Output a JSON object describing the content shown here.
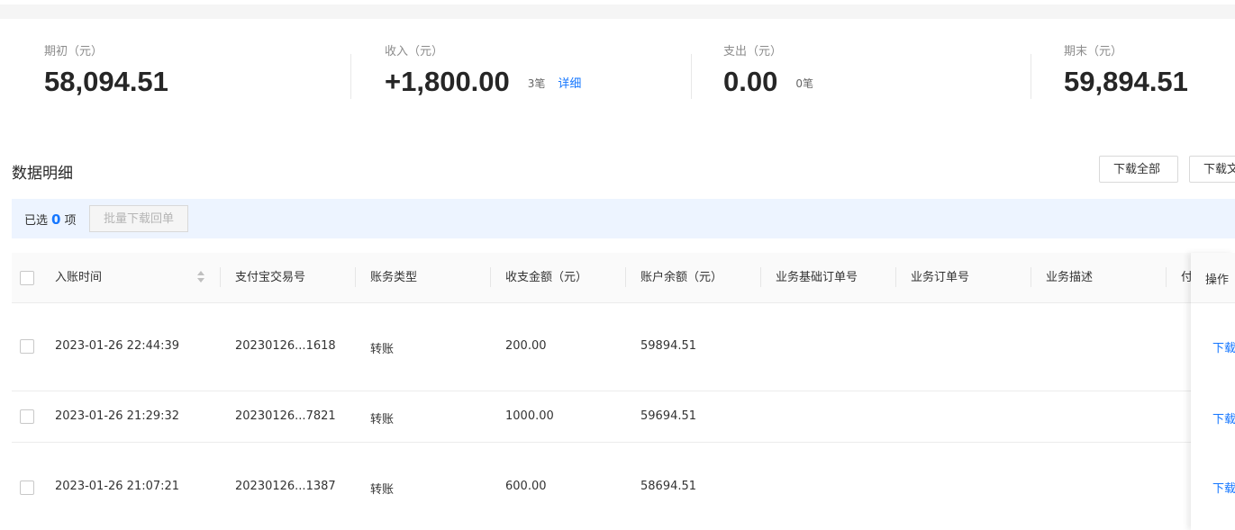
{
  "summary": {
    "opening": {
      "label": "期初（元）",
      "value": "58,094.51"
    },
    "income": {
      "label": "收入（元）",
      "value": "+1,800.00",
      "count": "3笔",
      "detail_link": "详细"
    },
    "expense": {
      "label": "支出（元）",
      "value": "0.00",
      "count": "0笔"
    },
    "closing": {
      "label": "期末（元）",
      "value": "59,894.51"
    }
  },
  "section": {
    "title": "数据明细",
    "download_all": "下载全部",
    "download_other": "下载文"
  },
  "selection": {
    "prefix": "已选",
    "count": "0",
    "suffix": "项",
    "batch_download": "批量下载回单"
  },
  "table": {
    "columns": [
      "入账时间",
      "支付宝交易号",
      "账务类型",
      "收支金额（元）",
      "账户余额（元）",
      "业务基础订单号",
      "业务订单号",
      "业务描述",
      "付"
    ],
    "action_header": "操作",
    "rows": [
      {
        "time": "2023-01-26 22:44:39",
        "trade_no": "20230126...1618",
        "type": "转账",
        "amount": "200.00",
        "balance": "59894.51",
        "action": "下载"
      },
      {
        "time": "2023-01-26 21:29:32",
        "trade_no": "20230126...7821",
        "type": "转账",
        "amount": "1000.00",
        "balance": "59694.51",
        "action": "下载"
      },
      {
        "time": "2023-01-26 21:07:21",
        "trade_no": "20230126...1387",
        "type": "转账",
        "amount": "600.00",
        "balance": "58694.51",
        "action": "下载"
      }
    ]
  }
}
